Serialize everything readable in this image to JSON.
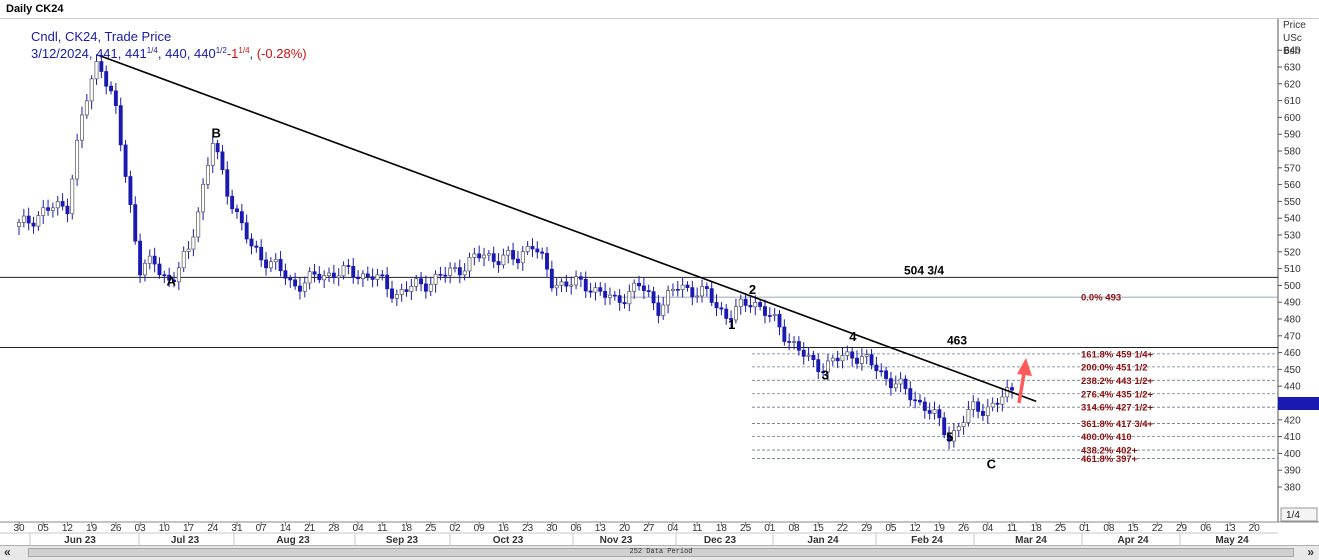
{
  "window": {
    "title": "Daily CK24"
  },
  "legend": {
    "line1": "Cndl, CK24, Trade Price",
    "date": "3/12/2024",
    "open": "441",
    "high_main": "441",
    "high_frac": "1/4",
    "low": "440",
    "close_main": "440",
    "close_frac": "1/2",
    "change_main": "-1",
    "change_frac": "1/4",
    "change_pct": "(-0.28%)"
  },
  "axis_header": {
    "line1": "Price",
    "line2": "USc",
    "line3": "Bsh"
  },
  "last_price_tag": "440",
  "scroll": {
    "period_label": "252 Data Period",
    "nav_left": "«",
    "nav_right": "»"
  },
  "colors": {
    "up": "#ffffff",
    "down": "#1a1ab0",
    "wick": "#1a1ab0",
    "trend": "#000000",
    "fib": "#607080",
    "fib_text": "#8b1010",
    "arrow": "#ff5a5a"
  },
  "chart_data": {
    "type": "candlestick",
    "yaxis": {
      "ticks": [
        380,
        390,
        400,
        410,
        420,
        430,
        440,
        450,
        460,
        470,
        480,
        490,
        500,
        510,
        520,
        530,
        540,
        550,
        560,
        570,
        580,
        590,
        600,
        610,
        620,
        630,
        640
      ],
      "range": [
        374,
        648
      ],
      "position": "right"
    },
    "xaxis": {
      "day_labels": [
        "30",
        "05",
        "12",
        "19",
        "26",
        "03",
        "10",
        "17",
        "24",
        "31",
        "07",
        "14",
        "21",
        "28",
        "04",
        "11",
        "18",
        "25",
        "02",
        "09",
        "16",
        "23",
        "30",
        "06",
        "13",
        "20",
        "27",
        "04",
        "11",
        "18",
        "25",
        "01",
        "08",
        "15",
        "22",
        "29",
        "05",
        "12",
        "19",
        "26",
        "04",
        "11",
        "18",
        "25",
        "01",
        "08",
        "15",
        "22",
        "29",
        "06",
        "13",
        "20"
      ],
      "month_labels": [
        "Jun 23",
        "Jul 23",
        "Aug 23",
        "Sep 23",
        "Oct 23",
        "Nov 23",
        "Dec 23",
        "Jan 24",
        "Feb 24",
        "Mar 24",
        "Apr 24",
        "May 24"
      ],
      "page_label": "1/4"
    },
    "horizontal_levels": [
      {
        "value": 504.75,
        "label": "504 3/4"
      },
      {
        "value": 463,
        "label": "463"
      }
    ],
    "fib_levels": [
      {
        "value": 493,
        "label": "0.0%   493"
      },
      {
        "value": 459.25,
        "label": "161.8% 459 1/4+"
      },
      {
        "value": 451.5,
        "label": "200.0% 451 1/2"
      },
      {
        "value": 443.5,
        "label": "238.2% 443 1/2+"
      },
      {
        "value": 435.5,
        "label": "276.4% 435 1/2+"
      },
      {
        "value": 427.5,
        "label": "314.6% 427 1/2+"
      },
      {
        "value": 417.75,
        "label": "361.8% 417 3/4+"
      },
      {
        "value": 410,
        "label": "400.0% 410"
      },
      {
        "value": 402,
        "label": "438.2% 402+"
      },
      {
        "value": 397,
        "label": "461.8% 397+"
      }
    ],
    "trendline": {
      "start": {
        "date": "2023-06-21",
        "value": 637
      },
      "end": {
        "date": "2024-03-18",
        "value": 431
      }
    },
    "wave_labels": [
      {
        "text": "A",
        "date": "2023-07-12",
        "value": 500
      },
      {
        "text": "B",
        "date": "2023-07-25",
        "value": 588
      },
      {
        "text": "1",
        "date": "2023-12-21",
        "value": 474
      },
      {
        "text": "2",
        "date": "2023-12-27",
        "value": 495
      },
      {
        "text": "3",
        "date": "2024-01-17",
        "value": 444
      },
      {
        "text": "4",
        "date": "2024-01-25",
        "value": 467
      },
      {
        "text": "5",
        "date": "2024-02-22",
        "value": 407
      },
      {
        "text": "C",
        "date": "2024-03-05",
        "value": 391
      }
    ],
    "price_path": [
      {
        "date": "2023-05-29",
        "close": 535
      },
      {
        "date": "2023-06-05",
        "close": 544
      },
      {
        "date": "2023-06-12",
        "close": 548
      },
      {
        "date": "2023-06-16",
        "close": 598
      },
      {
        "date": "2023-06-21",
        "close": 637
      },
      {
        "date": "2023-06-26",
        "close": 603
      },
      {
        "date": "2023-07-03",
        "close": 510
      },
      {
        "date": "2023-07-07",
        "close": 513
      },
      {
        "date": "2023-07-12",
        "close": 502
      },
      {
        "date": "2023-07-17",
        "close": 520
      },
      {
        "date": "2023-07-24",
        "close": 585
      },
      {
        "date": "2023-07-28",
        "close": 558
      },
      {
        "date": "2023-08-04",
        "close": 522
      },
      {
        "date": "2023-08-11",
        "close": 512
      },
      {
        "date": "2023-08-16",
        "close": 500
      },
      {
        "date": "2023-08-28",
        "close": 508
      },
      {
        "date": "2023-09-08",
        "close": 506
      },
      {
        "date": "2023-09-15",
        "close": 495
      },
      {
        "date": "2023-09-29",
        "close": 506
      },
      {
        "date": "2023-10-10",
        "close": 518
      },
      {
        "date": "2023-10-20",
        "close": 515
      },
      {
        "date": "2023-10-24",
        "close": 527
      },
      {
        "date": "2023-10-30",
        "close": 502
      },
      {
        "date": "2023-11-10",
        "close": 500
      },
      {
        "date": "2023-11-17",
        "close": 490
      },
      {
        "date": "2023-11-24",
        "close": 500
      },
      {
        "date": "2023-11-30",
        "close": 487
      },
      {
        "date": "2023-12-06",
        "close": 500
      },
      {
        "date": "2023-12-14",
        "close": 494
      },
      {
        "date": "2023-12-20",
        "close": 481
      },
      {
        "date": "2023-12-27",
        "close": 492
      },
      {
        "date": "2024-01-05",
        "close": 472
      },
      {
        "date": "2024-01-12",
        "close": 455
      },
      {
        "date": "2024-01-17",
        "close": 452
      },
      {
        "date": "2024-01-25",
        "close": 460
      },
      {
        "date": "2024-02-01",
        "close": 450
      },
      {
        "date": "2024-02-09",
        "close": 437
      },
      {
        "date": "2024-02-15",
        "close": 428
      },
      {
        "date": "2024-02-22",
        "close": 410
      },
      {
        "date": "2024-02-29",
        "close": 427
      },
      {
        "date": "2024-03-06",
        "close": 428
      },
      {
        "date": "2024-03-12",
        "close": 440.5
      }
    ]
  }
}
